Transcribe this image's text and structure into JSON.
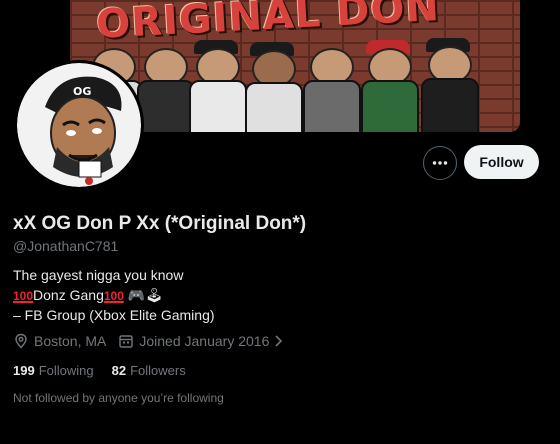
{
  "banner": {
    "title_text": "ORIGINAL DON",
    "background_color": "#7a3b2e"
  },
  "profile": {
    "display_name": "xX OG Don P Xx (*Original Don*)",
    "handle": "@JonathanC781",
    "bio_lines": [
      "The gayest nigga you know",
      "Donz Gang",
      "– FB Group (Xbox Elite Gaming)"
    ],
    "bio_emoji": [
      "100",
      "100",
      "🎮",
      "🕹"
    ],
    "location": "Boston, MA",
    "joined": "Joined January 2016",
    "following_count": "199",
    "following_label": "Following",
    "followers_count": "82",
    "followers_label": "Followers",
    "not_followed_text": "Not followed by anyone you’re following"
  },
  "actions": {
    "more_icon": "more-horizontal-icon",
    "follow_label": "Follow"
  },
  "colors": {
    "accent_button_bg": "#eff3f4",
    "muted_text": "#71767b",
    "primary_text": "#e7e9ea"
  }
}
